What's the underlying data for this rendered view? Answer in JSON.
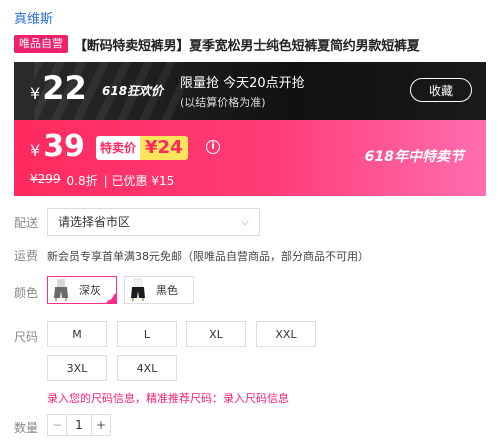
{
  "store": {
    "brand": "真维斯"
  },
  "product": {
    "tag": "唯品自营",
    "title": "【断码特卖短裤男】夏季宽松男士纯色短裤夏简约男款短裤夏"
  },
  "flash_sale": {
    "currency": "¥",
    "price": "22",
    "event_label": "618狂欢价",
    "headline": "限量抢 今天20点开抢",
    "note": "(以结算价格为准)",
    "favorite_label": "收藏"
  },
  "current_price": {
    "currency": "¥",
    "price": "39",
    "badge_label": "特卖价",
    "badge_price": "¥24",
    "info_icon": "info-icon",
    "original_price": "¥299",
    "discount": "0.8折",
    "saved": "| 已优惠 ¥15",
    "event_banner": "618年中特卖节"
  },
  "delivery": {
    "label": "配送",
    "select_value": "请选择省市区",
    "select_icon": "chevron-down-icon"
  },
  "shipping": {
    "label": "运费",
    "text": "新会员专享首单满38元免邮（限唯品自营商品，部分商品不可用）"
  },
  "colors": {
    "label": "颜色",
    "options": [
      {
        "name": "深灰",
        "selected": true
      },
      {
        "name": "黑色",
        "selected": false
      }
    ]
  },
  "sizes": {
    "label": "尺码",
    "options": [
      "M",
      "L",
      "XL",
      "XXL",
      "3XL",
      "4XL"
    ]
  },
  "size_tip": {
    "text": "录入您的尺码信息，精准推荐尺码：",
    "link": "录入尺码信息"
  },
  "quantity": {
    "label": "数量",
    "value": "1",
    "minus": "−",
    "plus": "+"
  },
  "theme": {
    "accent": "#ff2a5e",
    "link_blue": "#2a6fd6",
    "highlight_yellow": "#ffe45c"
  }
}
